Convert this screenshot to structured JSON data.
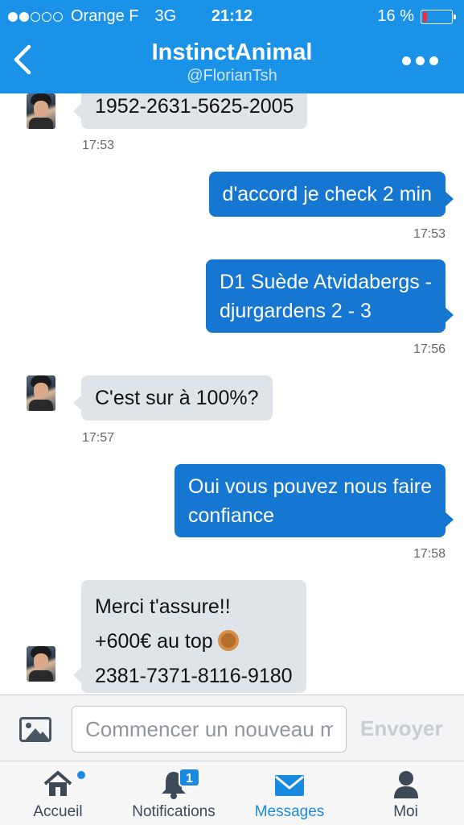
{
  "status_bar": {
    "carrier": "Orange F",
    "network": "3G",
    "time": "21:12",
    "battery": "16 %",
    "battery_level": 0.16,
    "signal_dots_filled": 2,
    "signal_dots_total": 5
  },
  "header": {
    "title": "InstinctAnimal",
    "subtitle": "@FlorianTsh",
    "back_icon": "chevron-left-icon",
    "more_icon": "more-dots-icon"
  },
  "messages": [
    {
      "direction": "in",
      "lines": [
        "1952-2631-5625-2005"
      ],
      "time": "17:53"
    },
    {
      "direction": "out",
      "lines": [
        "d'accord je check 2 min"
      ],
      "time": "17:53"
    },
    {
      "direction": "out",
      "lines": [
        "D1 Suède Atvidabergs -",
        "djurgardens 2 - 3"
      ],
      "time": "17:56"
    },
    {
      "direction": "in",
      "lines": [
        "C'est sur à 100%?"
      ],
      "time": "17:57"
    },
    {
      "direction": "out",
      "lines": [
        "Oui vous pouvez nous faire",
        "confiance"
      ],
      "time": "17:58"
    },
    {
      "direction": "in",
      "lines": [
        "Merci t'assure!!",
        "+600€ au top",
        "2381-7371-8116-9180"
      ],
      "time": "",
      "emoji": "ok-hand-emoji"
    }
  ],
  "composer": {
    "photo_icon": "photo-icon",
    "placeholder": "Commencer un nouveau message",
    "send_label": "Envoyer"
  },
  "tabs": [
    {
      "label": "Accueil",
      "icon": "home-icon",
      "active": false
    },
    {
      "label": "Notifications",
      "icon": "bell-icon",
      "active": false,
      "badge": "1"
    },
    {
      "label": "Messages",
      "icon": "envelope-icon",
      "active": true
    },
    {
      "label": "Moi",
      "icon": "person-icon",
      "active": false
    }
  ],
  "colors": {
    "header": "#1992e8",
    "outgoing_bubble": "#1577d2",
    "incoming_bubble": "#dfe4e9",
    "active_tab": "#1a8ae0"
  }
}
